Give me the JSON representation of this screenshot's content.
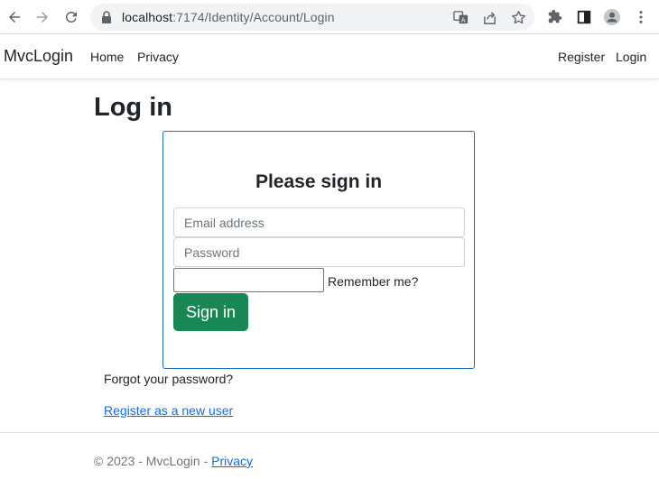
{
  "browser": {
    "url_host": "localhost",
    "url_path": ":7174/Identity/Account/Login",
    "icons": [
      "back-arrow-icon",
      "forward-arrow-icon",
      "reload-icon",
      "lock-icon",
      "translate-icon",
      "share-icon",
      "star-icon",
      "extensions-icon",
      "side-panel-icon",
      "profile-icon",
      "more-vert-icon"
    ]
  },
  "navbar": {
    "brand": "MvcLogin",
    "home": "Home",
    "privacy": "Privacy",
    "register": "Register",
    "login": "Login"
  },
  "main": {
    "title": "Log in",
    "card": {
      "heading": "Please sign in",
      "email_placeholder": "Email address",
      "password_placeholder": "Password",
      "remember_label": "Remember me?",
      "signin_label": "Sign in"
    },
    "forgot_password": "Forgot your password?",
    "register_new": "Register as a new user"
  },
  "footer": {
    "copyright": "© 2023 - MvcLogin - ",
    "privacy": "Privacy"
  },
  "colors": {
    "primary_link": "#0d6efd",
    "success_button": "#198754",
    "card_border": "#1c6fb8"
  }
}
